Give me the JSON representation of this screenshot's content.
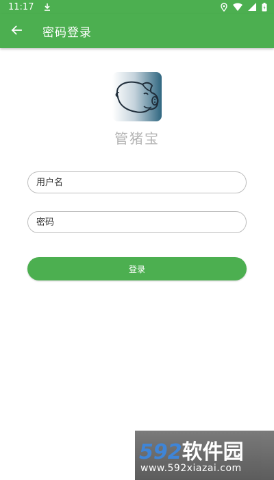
{
  "status_bar": {
    "time": "11:17",
    "icons": [
      "download-icon",
      "location-icon",
      "wifi-icon",
      "signal-icon",
      "battery-icon"
    ]
  },
  "app_bar": {
    "title": "密码登录",
    "back_icon": "arrow-left-icon",
    "color": "#4caf50"
  },
  "logo": {
    "icon": "pig-icon",
    "app_name": "管猪宝"
  },
  "form": {
    "username_placeholder": "用户名",
    "password_placeholder": "密码",
    "login_label": "登录"
  },
  "watermark": {
    "brand_number": "592",
    "brand_text": "软件园",
    "url": "www.592xiazai.com"
  }
}
